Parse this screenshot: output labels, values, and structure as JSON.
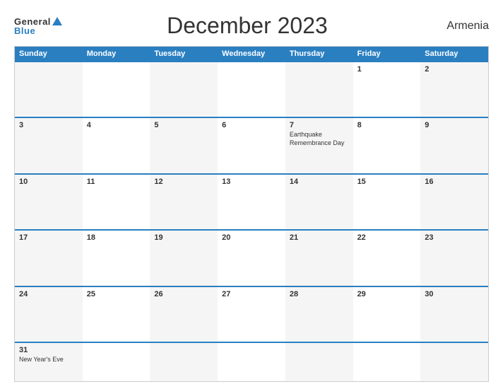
{
  "header": {
    "logo_general": "General",
    "logo_blue": "Blue",
    "title": "December 2023",
    "country": "Armenia"
  },
  "calendar": {
    "days": [
      "Sunday",
      "Monday",
      "Tuesday",
      "Wednesday",
      "Thursday",
      "Friday",
      "Saturday"
    ],
    "weeks": [
      [
        {
          "date": "",
          "event": ""
        },
        {
          "date": "",
          "event": ""
        },
        {
          "date": "",
          "event": ""
        },
        {
          "date": "",
          "event": ""
        },
        {
          "date": "",
          "event": ""
        },
        {
          "date": "1",
          "event": ""
        },
        {
          "date": "2",
          "event": ""
        }
      ],
      [
        {
          "date": "3",
          "event": ""
        },
        {
          "date": "4",
          "event": ""
        },
        {
          "date": "5",
          "event": ""
        },
        {
          "date": "6",
          "event": ""
        },
        {
          "date": "7",
          "event": "Earthquake\nRemembrance Day"
        },
        {
          "date": "8",
          "event": ""
        },
        {
          "date": "9",
          "event": ""
        }
      ],
      [
        {
          "date": "10",
          "event": ""
        },
        {
          "date": "11",
          "event": ""
        },
        {
          "date": "12",
          "event": ""
        },
        {
          "date": "13",
          "event": ""
        },
        {
          "date": "14",
          "event": ""
        },
        {
          "date": "15",
          "event": ""
        },
        {
          "date": "16",
          "event": ""
        }
      ],
      [
        {
          "date": "17",
          "event": ""
        },
        {
          "date": "18",
          "event": ""
        },
        {
          "date": "19",
          "event": ""
        },
        {
          "date": "20",
          "event": ""
        },
        {
          "date": "21",
          "event": ""
        },
        {
          "date": "22",
          "event": ""
        },
        {
          "date": "23",
          "event": ""
        }
      ],
      [
        {
          "date": "24",
          "event": ""
        },
        {
          "date": "25",
          "event": ""
        },
        {
          "date": "26",
          "event": ""
        },
        {
          "date": "27",
          "event": ""
        },
        {
          "date": "28",
          "event": ""
        },
        {
          "date": "29",
          "event": ""
        },
        {
          "date": "30",
          "event": ""
        }
      ],
      [
        {
          "date": "31",
          "event": "New Year's Eve"
        },
        {
          "date": "",
          "event": ""
        },
        {
          "date": "",
          "event": ""
        },
        {
          "date": "",
          "event": ""
        },
        {
          "date": "",
          "event": ""
        },
        {
          "date": "",
          "event": ""
        },
        {
          "date": "",
          "event": ""
        }
      ]
    ]
  }
}
